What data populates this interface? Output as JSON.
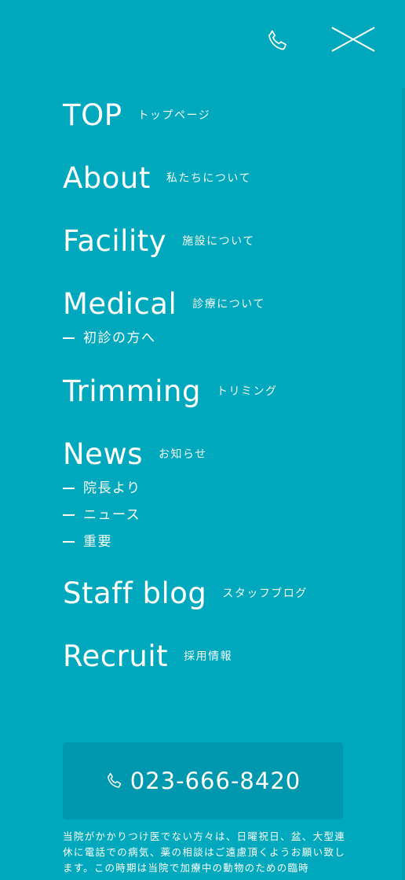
{
  "header": {
    "phone_icon": "phone-icon",
    "close_icon": "close-icon"
  },
  "nav": {
    "items": [
      {
        "en": "TOP",
        "ja": "トップページ",
        "subs": []
      },
      {
        "en": "About",
        "ja": "私たちについて",
        "subs": []
      },
      {
        "en": "Facility",
        "ja": "施設について",
        "subs": []
      },
      {
        "en": "Medical",
        "ja": "診療について",
        "subs": [
          "初診の方へ"
        ]
      },
      {
        "en": "Trimming",
        "ja": "トリミング",
        "subs": []
      },
      {
        "en": "News",
        "ja": "お知らせ",
        "subs": [
          "院長より",
          "ニュース",
          "重要"
        ]
      },
      {
        "en": "Staff blog",
        "ja": "スタッフブログ",
        "subs": []
      },
      {
        "en": "Recruit",
        "ja": "採用情報",
        "subs": []
      }
    ]
  },
  "tel": {
    "number": "023-666-8420",
    "icon": "phone-icon"
  },
  "notice": {
    "text": "当院がかかりつけ医でない方々は、日曜祝日、盆、大型連休に電話での病気、薬の相談はご遠慮頂くようお願い致します。この時期は当院で加療中の動物のための臨時"
  },
  "colors": {
    "background": "#00a8bd",
    "tel_box": "#0098ae",
    "text": "#ffffff"
  }
}
